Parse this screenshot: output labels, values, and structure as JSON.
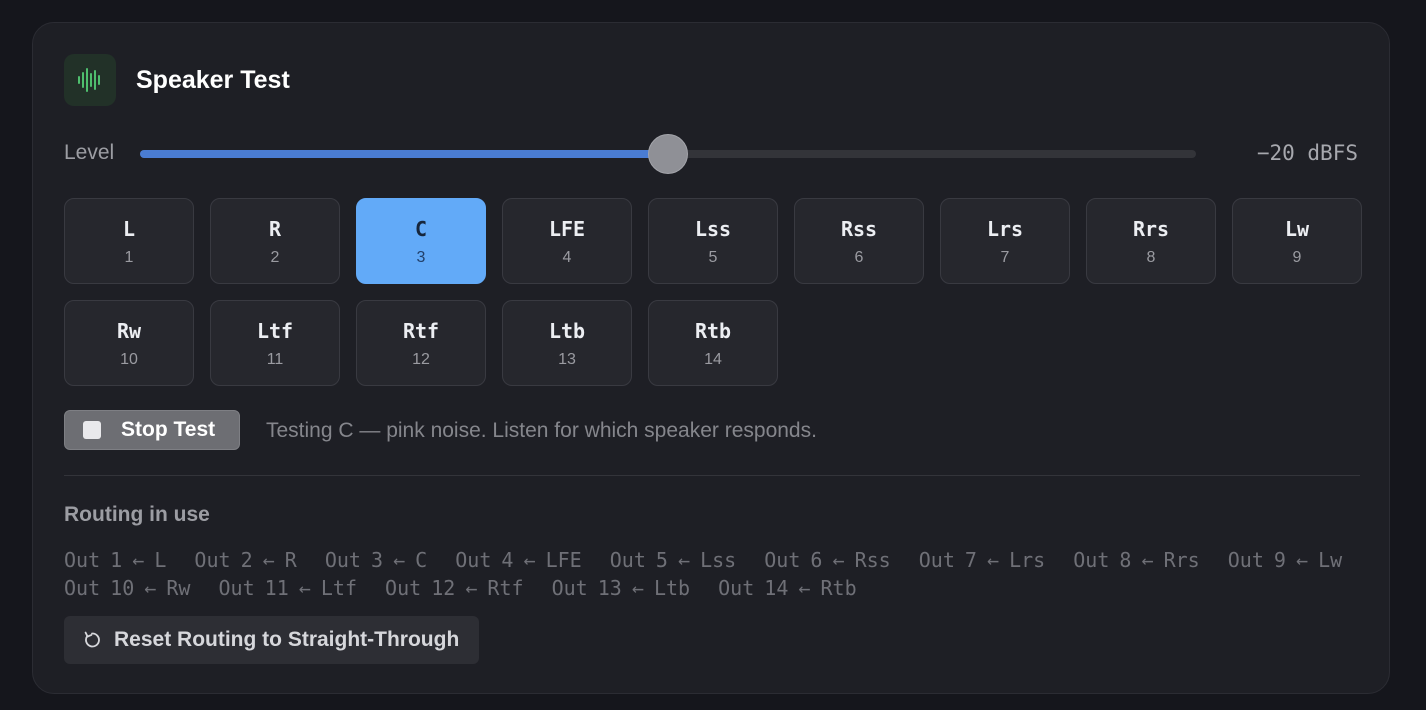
{
  "header": {
    "title": "Speaker Test",
    "icon": "waveform-icon",
    "icon_color": "#4fbf6e"
  },
  "level": {
    "label": "Level",
    "value_text": "−20 dBFS",
    "fraction": 0.5,
    "accent": "#4a7cd2"
  },
  "channels": [
    {
      "name": "L",
      "number": "1",
      "active": false
    },
    {
      "name": "R",
      "number": "2",
      "active": false
    },
    {
      "name": "C",
      "number": "3",
      "active": true
    },
    {
      "name": "LFE",
      "number": "4",
      "active": false
    },
    {
      "name": "Lss",
      "number": "5",
      "active": false
    },
    {
      "name": "Rss",
      "number": "6",
      "active": false
    },
    {
      "name": "Lrs",
      "number": "7",
      "active": false
    },
    {
      "name": "Rrs",
      "number": "8",
      "active": false
    },
    {
      "name": "Lw",
      "number": "9",
      "active": false
    },
    {
      "name": "Rw",
      "number": "10",
      "active": false
    },
    {
      "name": "Ltf",
      "number": "11",
      "active": false
    },
    {
      "name": "Rtf",
      "number": "12",
      "active": false
    },
    {
      "name": "Ltb",
      "number": "13",
      "active": false
    },
    {
      "name": "Rtb",
      "number": "14",
      "active": false
    }
  ],
  "active_color": "#62aaf8",
  "test": {
    "stop_label": "Stop Test",
    "status": "Testing C — pink noise. Listen for which speaker responds."
  },
  "routing": {
    "title": "Routing in use",
    "routes": [
      "Out 1 ← L",
      "Out 2 ← R",
      "Out 3 ← C",
      "Out 4 ← LFE",
      "Out 5 ← Lss",
      "Out 6 ← Rss",
      "Out 7 ← Lrs",
      "Out 8 ← Rrs",
      "Out 9 ← Lw",
      "Out 10 ← Rw",
      "Out 11 ← Ltf",
      "Out 12 ← Rtf",
      "Out 13 ← Ltb",
      "Out 14 ← Rtb"
    ],
    "reset_label": "Reset Routing to Straight-Through"
  }
}
